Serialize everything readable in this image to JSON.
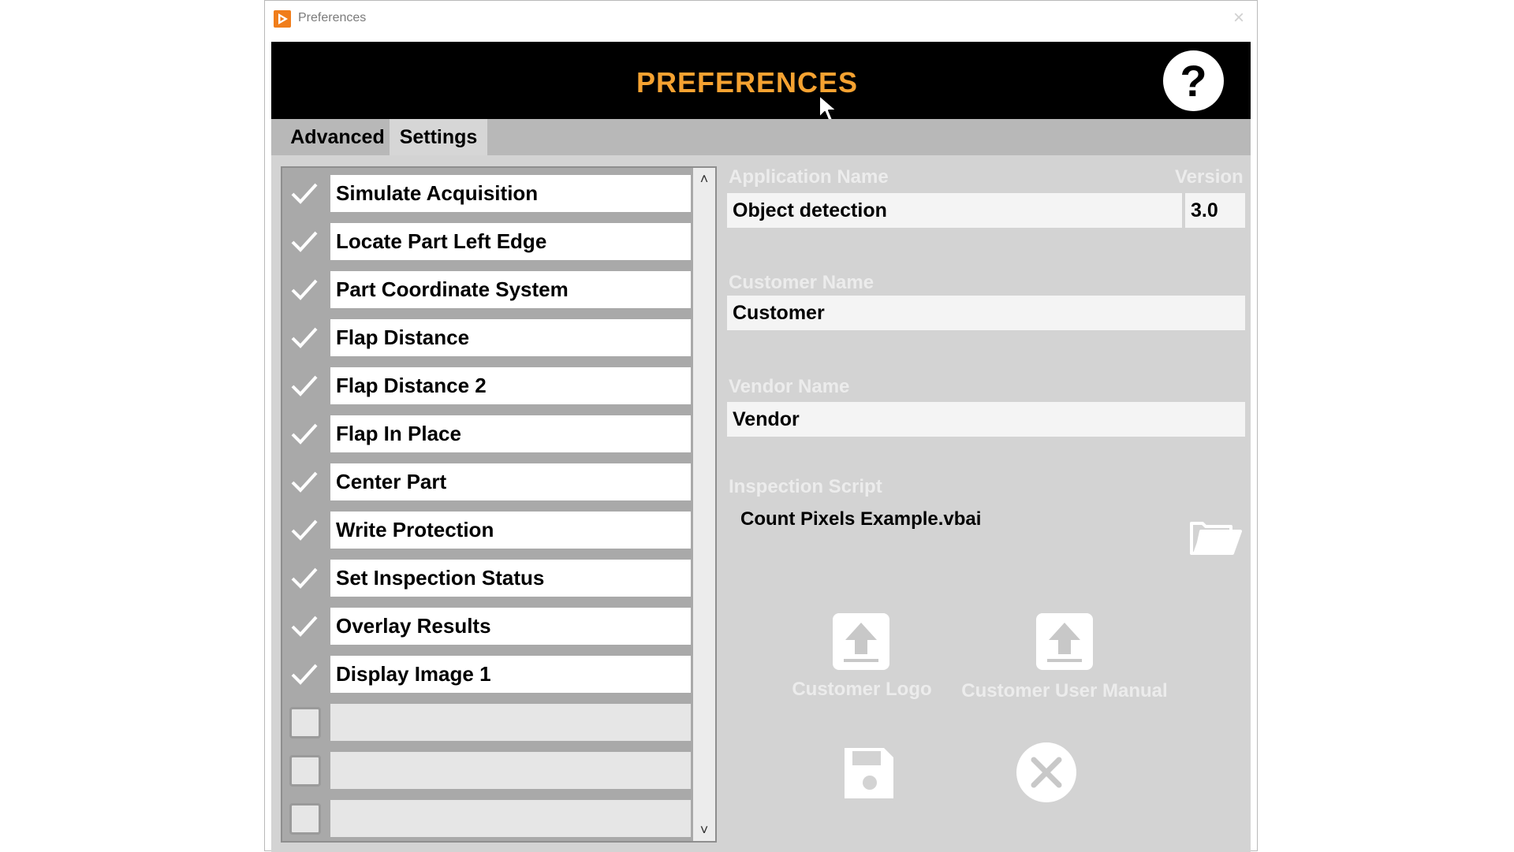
{
  "window": {
    "title": "Preferences",
    "icon": "app-play-icon",
    "close": "×"
  },
  "header": {
    "title": "PREFERENCES",
    "help": "?"
  },
  "tabs": [
    {
      "label": "Advanced",
      "active": true
    },
    {
      "label": "Settings",
      "active": false
    }
  ],
  "steps": {
    "items": [
      {
        "label": "Simulate Acquisition",
        "checked": true
      },
      {
        "label": "Locate Part Left Edge",
        "checked": true
      },
      {
        "label": "Part Coordinate System",
        "checked": true
      },
      {
        "label": "Flap Distance",
        "checked": true
      },
      {
        "label": "Flap Distance 2",
        "checked": true
      },
      {
        "label": "Flap In Place",
        "checked": true
      },
      {
        "label": "Center Part",
        "checked": true
      },
      {
        "label": "Write Protection",
        "checked": true
      },
      {
        "label": "Set Inspection Status",
        "checked": true
      },
      {
        "label": "Overlay Results",
        "checked": true
      },
      {
        "label": "Display Image 1",
        "checked": true
      },
      {
        "label": "",
        "checked": false
      },
      {
        "label": "",
        "checked": false
      },
      {
        "label": "",
        "checked": false
      }
    ],
    "scroll_up": "˄",
    "scroll_down": "˅"
  },
  "settings": {
    "application_name_label": "Application Name",
    "application_name": "Object detection",
    "version_label": "Version",
    "version": "3.0",
    "customer_name_label": "Customer Name",
    "customer_name": "Customer",
    "vendor_name_label": "Vendor Name",
    "vendor_name": "Vendor",
    "inspection_script_label": "Inspection Script",
    "inspection_script": "Count Pixels Example.vbai",
    "customer_logo_label": "Customer Logo",
    "customer_manual_label": "Customer User Manual"
  },
  "colors": {
    "accent": "#f5a231",
    "header_bg": "#000000",
    "panel_bg": "#d3d3d3",
    "muted_label": "#ececec"
  }
}
